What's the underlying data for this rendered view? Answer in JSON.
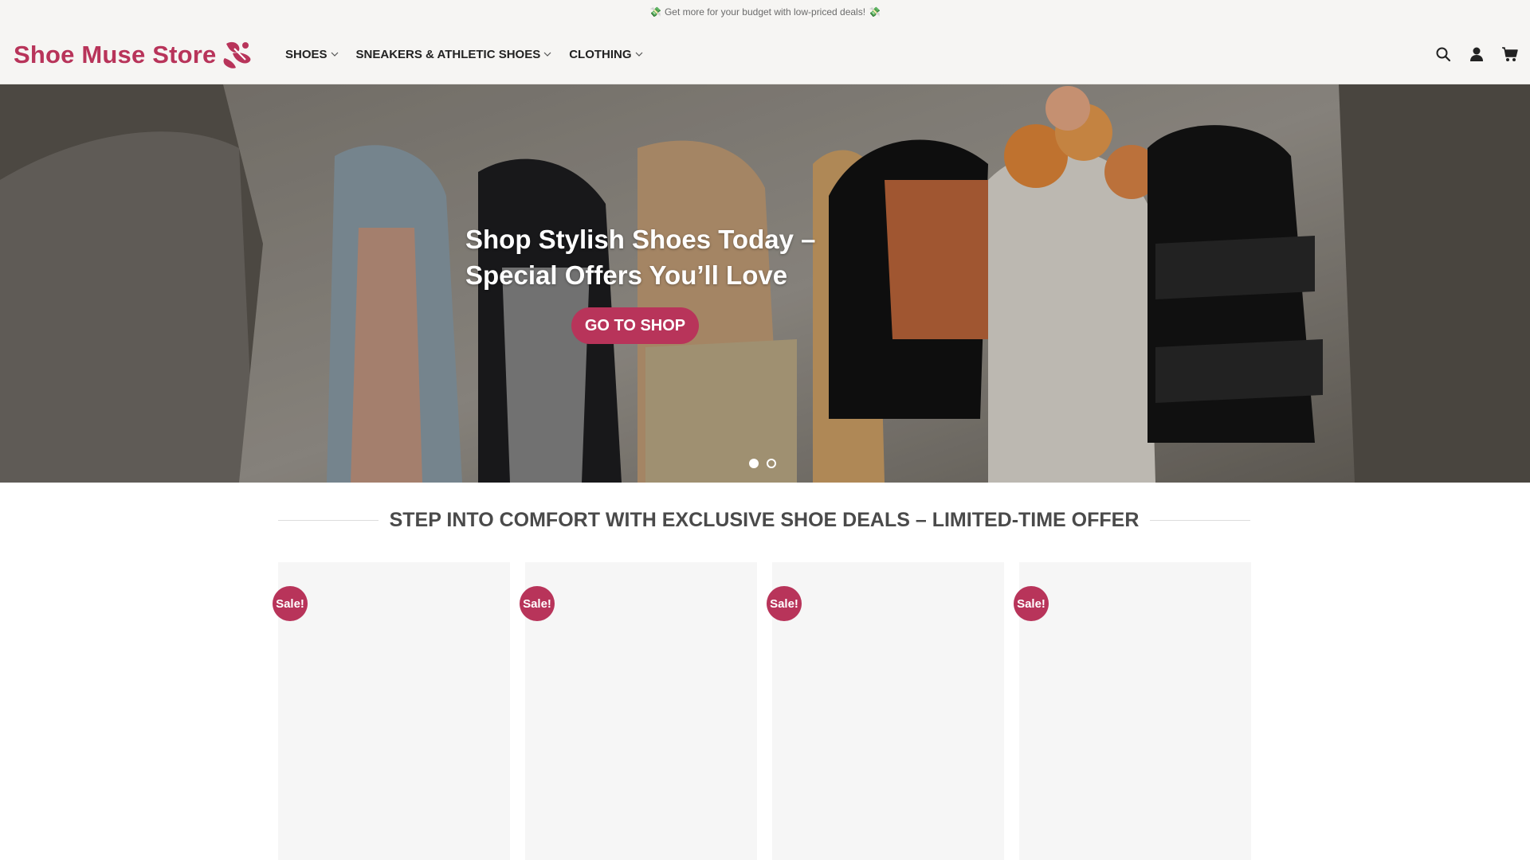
{
  "topbar": {
    "message": "Get more for your budget with low-priced deals!",
    "icon": "money-icon"
  },
  "brand": {
    "name": "Shoe Muse Store",
    "color": "#b8345a"
  },
  "nav": {
    "items": [
      {
        "label": "SHOES"
      },
      {
        "label": "SNEAKERS & ATHLETIC SHOES"
      },
      {
        "label": "CLOTHING"
      }
    ]
  },
  "header_icons": [
    "search-icon",
    "account-icon",
    "cart-icon"
  ],
  "hero": {
    "title": "Shop Stylish Shoes Today – Special Offers You’ll Love",
    "button_label": "GO TO SHOP",
    "slides_count": 2,
    "active_slide": 1
  },
  "section": {
    "title": "STEP INTO COMFORT WITH EXCLUSIVE SHOE DEALS – LIMITED-TIME OFFER"
  },
  "products": [
    {
      "badge": "Sale!"
    },
    {
      "badge": "Sale!"
    },
    {
      "badge": "Sale!"
    },
    {
      "badge": "Sale!"
    }
  ],
  "colors": {
    "accent": "#b8345a",
    "header_bg": "#f6f5f3",
    "card_bg": "#f6f6f6"
  }
}
